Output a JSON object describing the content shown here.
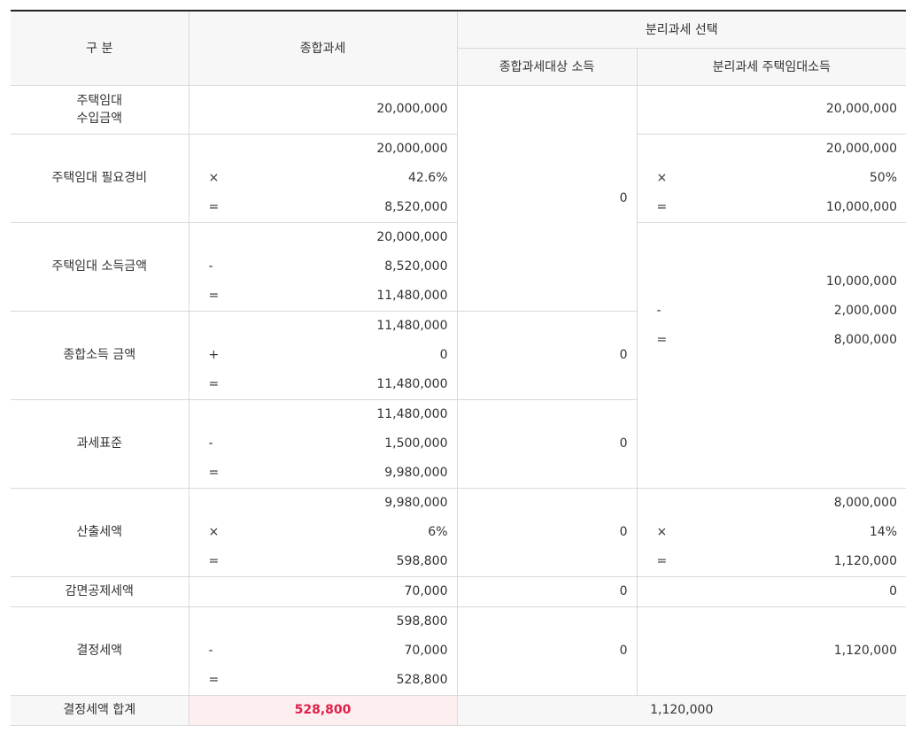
{
  "header": {
    "gubun": "구 분",
    "comprehensive": "종합과세",
    "separate_choice": "분리과세 선택",
    "separate_comp": "종합과세대상 소득",
    "separate_rent": "분리과세 주택임대소득"
  },
  "rows": {
    "revenue": {
      "label": "주택임대\n수입금액",
      "comp": "20,000,000",
      "sep_rent": "20,000,000"
    },
    "expense": {
      "label": "주택임대 필요경비",
      "comp": [
        {
          "op": "",
          "num": "20,000,000"
        },
        {
          "op": "×",
          "num": "42.6%"
        },
        {
          "op": "=",
          "num": "8,520,000"
        }
      ],
      "sep_comp": "0",
      "sep_rent": [
        {
          "op": "",
          "num": "20,000,000"
        },
        {
          "op": "×",
          "num": "50%"
        },
        {
          "op": "=",
          "num": "10,000,000"
        }
      ]
    },
    "income": {
      "label": "주택임대 소득금액",
      "comp": [
        {
          "op": "",
          "num": "20,000,000"
        },
        {
          "op": "-",
          "num": "8,520,000"
        },
        {
          "op": "=",
          "num": "11,480,000"
        }
      ]
    },
    "total_income": {
      "label": "종합소득 금액",
      "comp": [
        {
          "op": "",
          "num": "11,480,000"
        },
        {
          "op": "+",
          "num": "0"
        },
        {
          "op": "=",
          "num": "11,480,000"
        }
      ],
      "sep_comp": "0",
      "sep_rent": [
        {
          "op": "",
          "num": "10,000,000"
        },
        {
          "op": "-",
          "num": "2,000,000"
        },
        {
          "op": "=",
          "num": "8,000,000"
        }
      ]
    },
    "tax_base": {
      "label": "과세표준",
      "comp": [
        {
          "op": "",
          "num": "11,480,000"
        },
        {
          "op": "-",
          "num": "1,500,000"
        },
        {
          "op": "=",
          "num": "9,980,000"
        }
      ],
      "sep_comp": "0"
    },
    "calc_tax": {
      "label": "산출세액",
      "comp": [
        {
          "op": "",
          "num": "9,980,000"
        },
        {
          "op": "×",
          "num": "6%"
        },
        {
          "op": "=",
          "num": "598,800"
        }
      ],
      "sep_comp": "0",
      "sep_rent": [
        {
          "op": "",
          "num": "8,000,000"
        },
        {
          "op": "×",
          "num": "14%"
        },
        {
          "op": "=",
          "num": "1,120,000"
        }
      ]
    },
    "deduction": {
      "label": "감면공제세액",
      "comp": "70,000",
      "sep_comp": "0",
      "sep_rent": "0"
    },
    "final_tax": {
      "label": "결정세액",
      "comp": [
        {
          "op": "",
          "num": "598,800"
        },
        {
          "op": "-",
          "num": "70,000"
        },
        {
          "op": "=",
          "num": "528,800"
        }
      ],
      "sep_comp": "0",
      "sep_rent": "1,120,000"
    },
    "total": {
      "label": "결정세액 합계",
      "comp": "528,800",
      "separate": "1,120,000"
    }
  },
  "colors": {
    "highlight_bg": "#fdeef0",
    "highlight_text": "#e0204a",
    "header_bg": "#f7f7f7"
  }
}
